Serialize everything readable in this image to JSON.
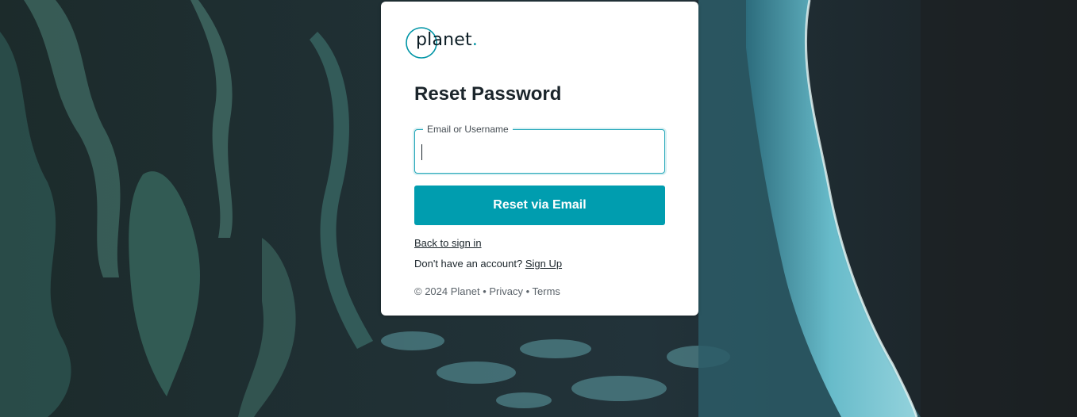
{
  "brand": {
    "name": "planet",
    "dot": ".",
    "accent_color": "#009daf"
  },
  "background": {
    "description_icon": "satellite-reef-image"
  },
  "form": {
    "title": "Reset Password",
    "field_label": "Email or Username",
    "field_value": "",
    "submit_label": "Reset via Email"
  },
  "links": {
    "back": "Back to sign in",
    "no_account": "Don't have an account?",
    "sign_up": "Sign Up"
  },
  "footer": {
    "copyright": "© 2024 Planet",
    "separator": " • ",
    "privacy": "Privacy",
    "terms": "Terms"
  }
}
